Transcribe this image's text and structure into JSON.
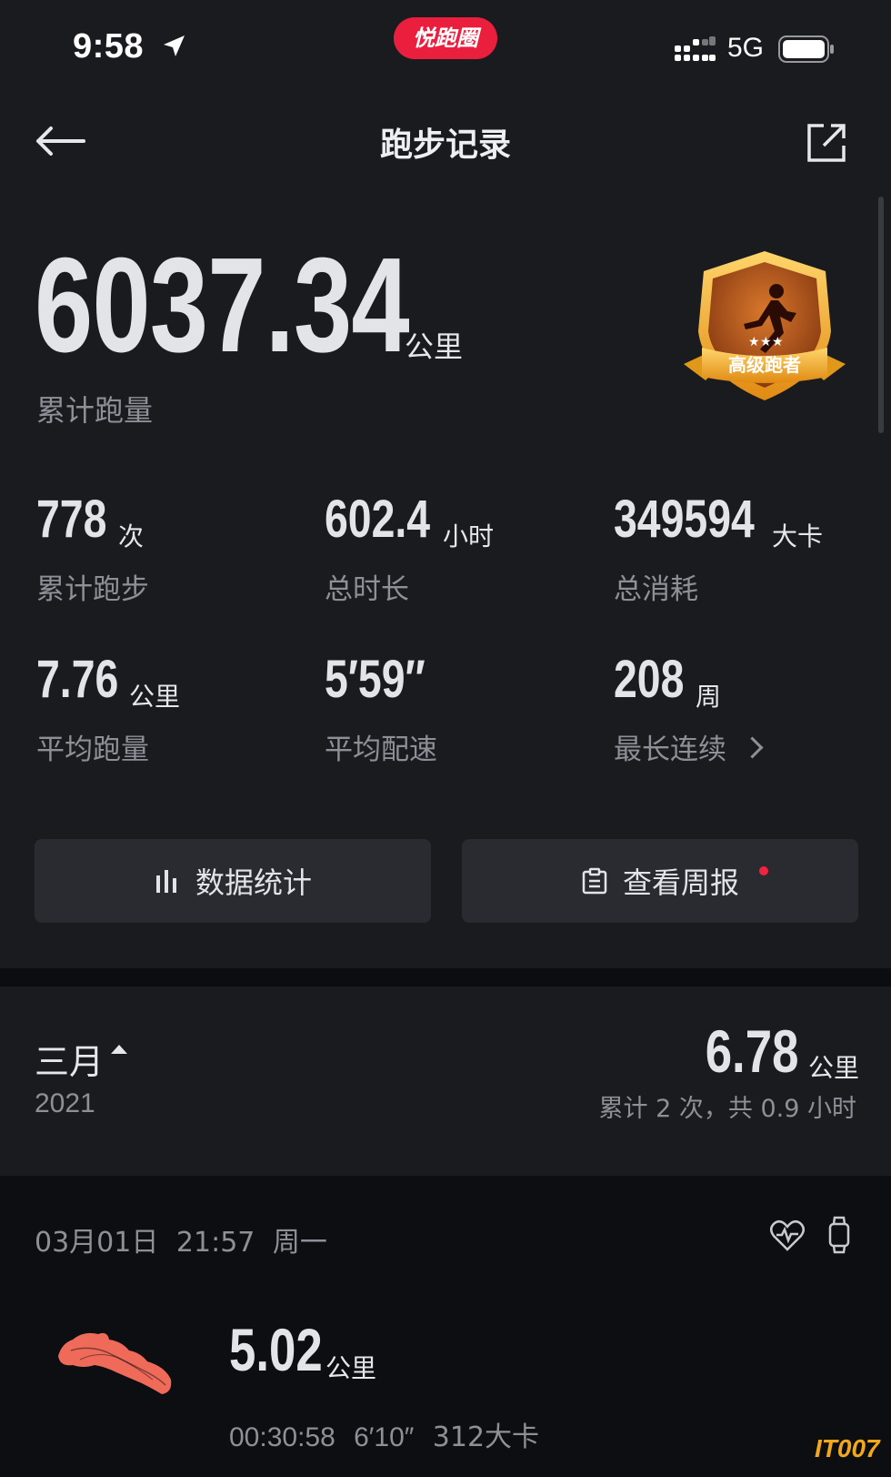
{
  "status_bar": {
    "time": "9:58",
    "app_pill": "悦跑圈",
    "network": "5G"
  },
  "nav": {
    "title": "跑步记录"
  },
  "hero": {
    "total_distance": "6037.34",
    "unit": "公里",
    "label": "累计跑量",
    "badge_label": "高级跑者"
  },
  "stats": [
    {
      "value": "778",
      "unit": "次",
      "label": "累计跑步"
    },
    {
      "value": "602.4",
      "unit": "小时",
      "label": "总时长"
    },
    {
      "value": "349594",
      "unit": "大卡",
      "label": "总消耗"
    },
    {
      "value": "7.76",
      "unit": "公里",
      "label": "平均跑量"
    },
    {
      "value": "5′59″",
      "unit": "",
      "label": "平均配速"
    },
    {
      "value": "208",
      "unit": "周",
      "label": "最长连续"
    }
  ],
  "actions": {
    "stats_label": "数据统计",
    "weekly_label": "查看周报"
  },
  "month": {
    "name": "三月",
    "year": "2021",
    "distance": "6.78",
    "unit": "公里",
    "summary": "累计 2 次，共 0.9 小时"
  },
  "runs": [
    {
      "date": "03月01日",
      "time": "21:57",
      "weekday": "周一",
      "distance": "5.02",
      "unit": "公里",
      "duration": "00:30:58",
      "pace": "6′10″",
      "calories": "312大卡"
    }
  ],
  "watermark": "IT007",
  "colors": {
    "accent": "#ea1f3d",
    "background": "#1a1b1f",
    "route": "#f06a5a",
    "badge_gold": "#f2a81d"
  }
}
